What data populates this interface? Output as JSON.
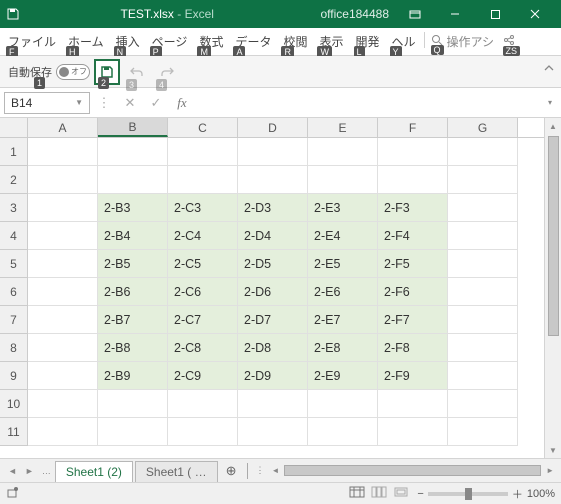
{
  "title": {
    "doc": "TEST.xlsx",
    "app": "Excel",
    "account": "office184488"
  },
  "ribbon": {
    "tabs": [
      {
        "label": "ファイル",
        "key": "F"
      },
      {
        "label": "ホーム",
        "key": "H"
      },
      {
        "label": "挿入",
        "key": "N"
      },
      {
        "label": "ページ",
        "key": "P"
      },
      {
        "label": "数式",
        "key": "M"
      },
      {
        "label": "データ",
        "key": "A"
      },
      {
        "label": "校閲",
        "key": "R"
      },
      {
        "label": "表示",
        "key": "W"
      },
      {
        "label": "開発",
        "key": "L"
      },
      {
        "label": "ヘル",
        "key": "Y"
      }
    ],
    "tell": "操作アシ",
    "tell_key": "Q",
    "share_key": "ZS"
  },
  "autosave": {
    "label": "自動保存",
    "state": "オフ",
    "key1": "1",
    "key2": "2",
    "key3": "3",
    "key4": "4"
  },
  "namebox": "B14",
  "sheet": {
    "columns": [
      "A",
      "B",
      "C",
      "D",
      "E",
      "F",
      "G"
    ],
    "active_col": "B",
    "active_row": 14,
    "rows": [
      1,
      2,
      3,
      4,
      5,
      6,
      7,
      8,
      9,
      10,
      11
    ],
    "data": {
      "3": {
        "B": "2-B3",
        "C": "2-C3",
        "D": "2-D3",
        "E": "2-E3",
        "F": "2-F3"
      },
      "4": {
        "B": "2-B4",
        "C": "2-C4",
        "D": "2-D4",
        "E": "2-E4",
        "F": "2-F4"
      },
      "5": {
        "B": "2-B5",
        "C": "2-C5",
        "D": "2-D5",
        "E": "2-E5",
        "F": "2-F5"
      },
      "6": {
        "B": "2-B6",
        "C": "2-C6",
        "D": "2-D6",
        "E": "2-E6",
        "F": "2-F6"
      },
      "7": {
        "B": "2-B7",
        "C": "2-C7",
        "D": "2-D7",
        "E": "2-E7",
        "F": "2-F7"
      },
      "8": {
        "B": "2-B8",
        "C": "2-C8",
        "D": "2-D8",
        "E": "2-E8",
        "F": "2-F8"
      },
      "9": {
        "B": "2-B9",
        "C": "2-C9",
        "D": "2-D9",
        "E": "2-E9",
        "F": "2-F9"
      }
    }
  },
  "tabs_bottom": {
    "active": "Sheet1 (2)",
    "other": "Sheet1 ( "
  },
  "status": {
    "zoom": "100%"
  }
}
